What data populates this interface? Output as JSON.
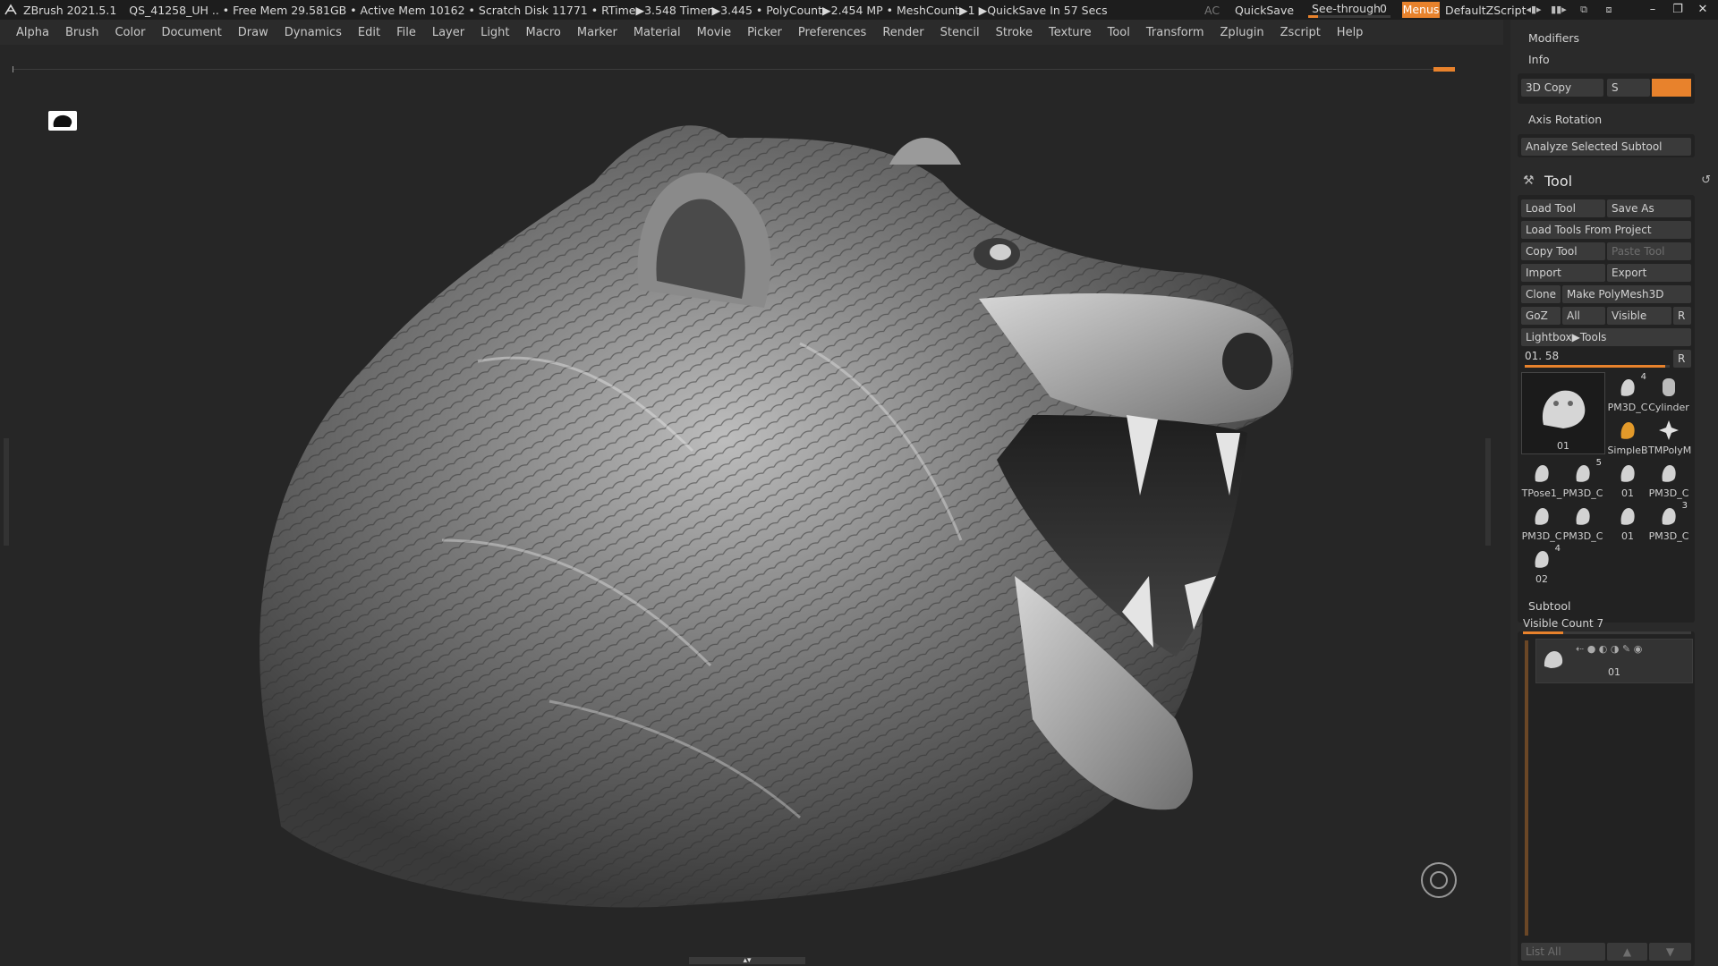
{
  "statusbar": {
    "app": "ZBrush 2021.5.1",
    "info": "QS_41258_UH   .. • Free Mem 29.581GB • Active Mem 10162 • Scratch Disk 11771 •  RTime▶3.548 Timer▶3.445 • PolyCount▶2.454 MP  • MeshCount▶1  ▶QuickSave In 57 Secs",
    "ac": "AC",
    "quicksave": "QuickSave",
    "see_through_label": "See-through",
    "see_through_value": "0",
    "see_through_level": 0.12,
    "menus": "Menus",
    "script": "DefaultZScript"
  },
  "menubar": [
    "Alpha",
    "Brush",
    "Color",
    "Document",
    "Draw",
    "Dynamics",
    "Edit",
    "File",
    "Layer",
    "Light",
    "Macro",
    "Marker",
    "Material",
    "Movie",
    "Picker",
    "Preferences",
    "Render",
    "Stencil",
    "Stroke",
    "Texture",
    "Tool",
    "Transform",
    "Zplugin",
    "Zscript",
    "Help"
  ],
  "panel": {
    "modifiers": "Modifiers",
    "info": "Info",
    "copy3d": "3D Copy",
    "s": "S",
    "axis_rotation": "Axis Rotation",
    "analyze": "Analyze Selected Subtool",
    "tool_title": "Tool",
    "load_tool": "Load Tool",
    "save_as": "Save As",
    "load_from_project": "Load Tools From Project",
    "copy_tool": "Copy Tool",
    "paste_tool": "Paste Tool",
    "import": "Import",
    "export": "Export",
    "clone": "Clone",
    "make_polymesh": "Make PolyMesh3D",
    "goz": "GoZ",
    "all": "All",
    "visible": "Visible",
    "r": "R",
    "lightbox": "Lightbox▶Tools",
    "tool_name": "01. 58",
    "tool_slider_level": 0.97,
    "main_thumb": "01",
    "thumbs": [
      {
        "label": "PM3D_C",
        "count": "4"
      },
      {
        "label": "Cylinder",
        "count": ""
      },
      {
        "label": "SimpleB",
        "count": ""
      },
      {
        "label": "TMPolyM",
        "count": ""
      },
      {
        "label": "TPose1_",
        "count": ""
      },
      {
        "label": "PM3D_C",
        "count": "5"
      },
      {
        "label": "01",
        "count": ""
      },
      {
        "label": "PM3D_C",
        "count": ""
      },
      {
        "label": "PM3D_C",
        "count": ""
      },
      {
        "label": "PM3D_C",
        "count": ""
      },
      {
        "label": "01",
        "count": ""
      },
      {
        "label": "PM3D_C",
        "count": "3"
      },
      {
        "label": "02",
        "count": "4"
      }
    ],
    "subtool": "Subtool",
    "visible_count": "Visible Count 7",
    "subtool_item": "01",
    "list_all": "List All"
  }
}
